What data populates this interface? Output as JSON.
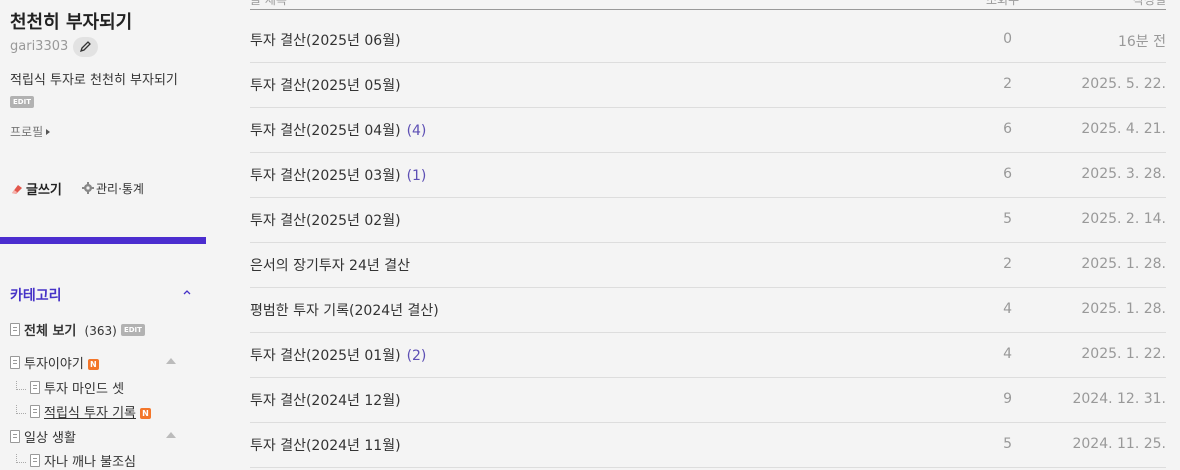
{
  "sidebar": {
    "blog_title": "천천히 부자되기",
    "user_id": "gari3303",
    "description": "적립식 투자로 천천히 부자되기",
    "edit_badge": "EDIT",
    "profile_label": "프로필",
    "write_label": "글쓰기",
    "admin_label": "관리·통계",
    "accent_color": "#4b2dcf"
  },
  "category": {
    "header": "카테고리",
    "all_label": "전체 보기",
    "all_count": "(363)",
    "new_badge": "N",
    "items": [
      {
        "label": "투자이야기"
      },
      {
        "label": "투자 마인드 셋"
      },
      {
        "label": "적립식 투자 기록"
      },
      {
        "label": "일상 생활"
      },
      {
        "label": "자나 깨나 불조심"
      }
    ]
  },
  "table": {
    "header": {
      "title": "글 제목",
      "views": "조회수",
      "date": "작성일"
    },
    "rows": [
      {
        "title": "투자 결산(2025년 06월)",
        "comments": "",
        "views": "0",
        "date": "16분 전"
      },
      {
        "title": "투자 결산(2025년 05월)",
        "comments": "",
        "views": "2",
        "date": "2025. 5. 22."
      },
      {
        "title": "투자 결산(2025년 04월)",
        "comments": "(4)",
        "views": "6",
        "date": "2025. 4. 21."
      },
      {
        "title": "투자 결산(2025년 03월)",
        "comments": "(1)",
        "views": "6",
        "date": "2025. 3. 28."
      },
      {
        "title": "투자 결산(2025년 02월)",
        "comments": "",
        "views": "5",
        "date": "2025. 2. 14."
      },
      {
        "title": "은서의 장기투자 24년 결산",
        "comments": "",
        "views": "2",
        "date": "2025. 1. 28."
      },
      {
        "title": "평범한 투자 기록(2024년 결산)",
        "comments": "",
        "views": "4",
        "date": "2025. 1. 28."
      },
      {
        "title": "투자 결산(2025년 01월)",
        "comments": "(2)",
        "views": "4",
        "date": "2025. 1. 22."
      },
      {
        "title": "투자 결산(2024년 12월)",
        "comments": "",
        "views": "9",
        "date": "2024. 12. 31."
      },
      {
        "title": "투자 결산(2024년 11월)",
        "comments": "",
        "views": "5",
        "date": "2024. 11. 25."
      }
    ]
  }
}
